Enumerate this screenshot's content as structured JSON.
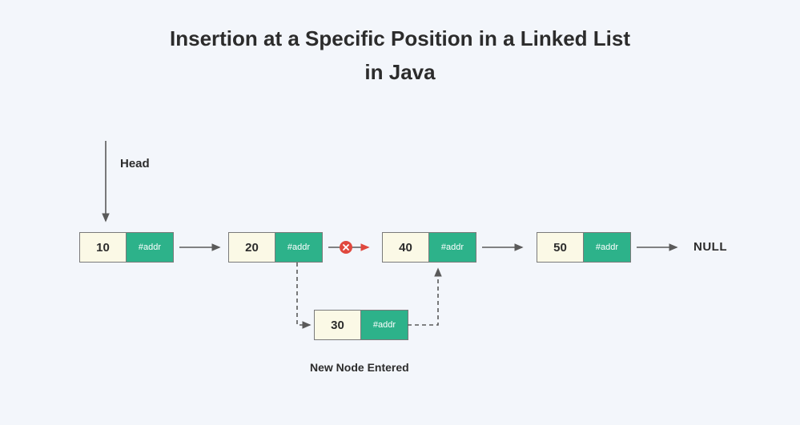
{
  "title_line1": "Insertion at a Specific Position in a Linked List",
  "title_line2": "in Java",
  "labels": {
    "head": "Head",
    "null": "NULL",
    "new_node": "New Node Entered"
  },
  "addr_text": "#addr",
  "nodes": {
    "n1": {
      "value": "10"
    },
    "n2": {
      "value": "20"
    },
    "n3": {
      "value": "40"
    },
    "n4": {
      "value": "50"
    },
    "new": {
      "value": "30"
    }
  },
  "colors": {
    "background": "#f3f6fb",
    "node_value_bg": "#fbf9e6",
    "node_addr_bg": "#2db28a",
    "text": "#2c2c2c",
    "arrow": "#5a5a5a",
    "broken_badge": "#e0483e"
  }
}
